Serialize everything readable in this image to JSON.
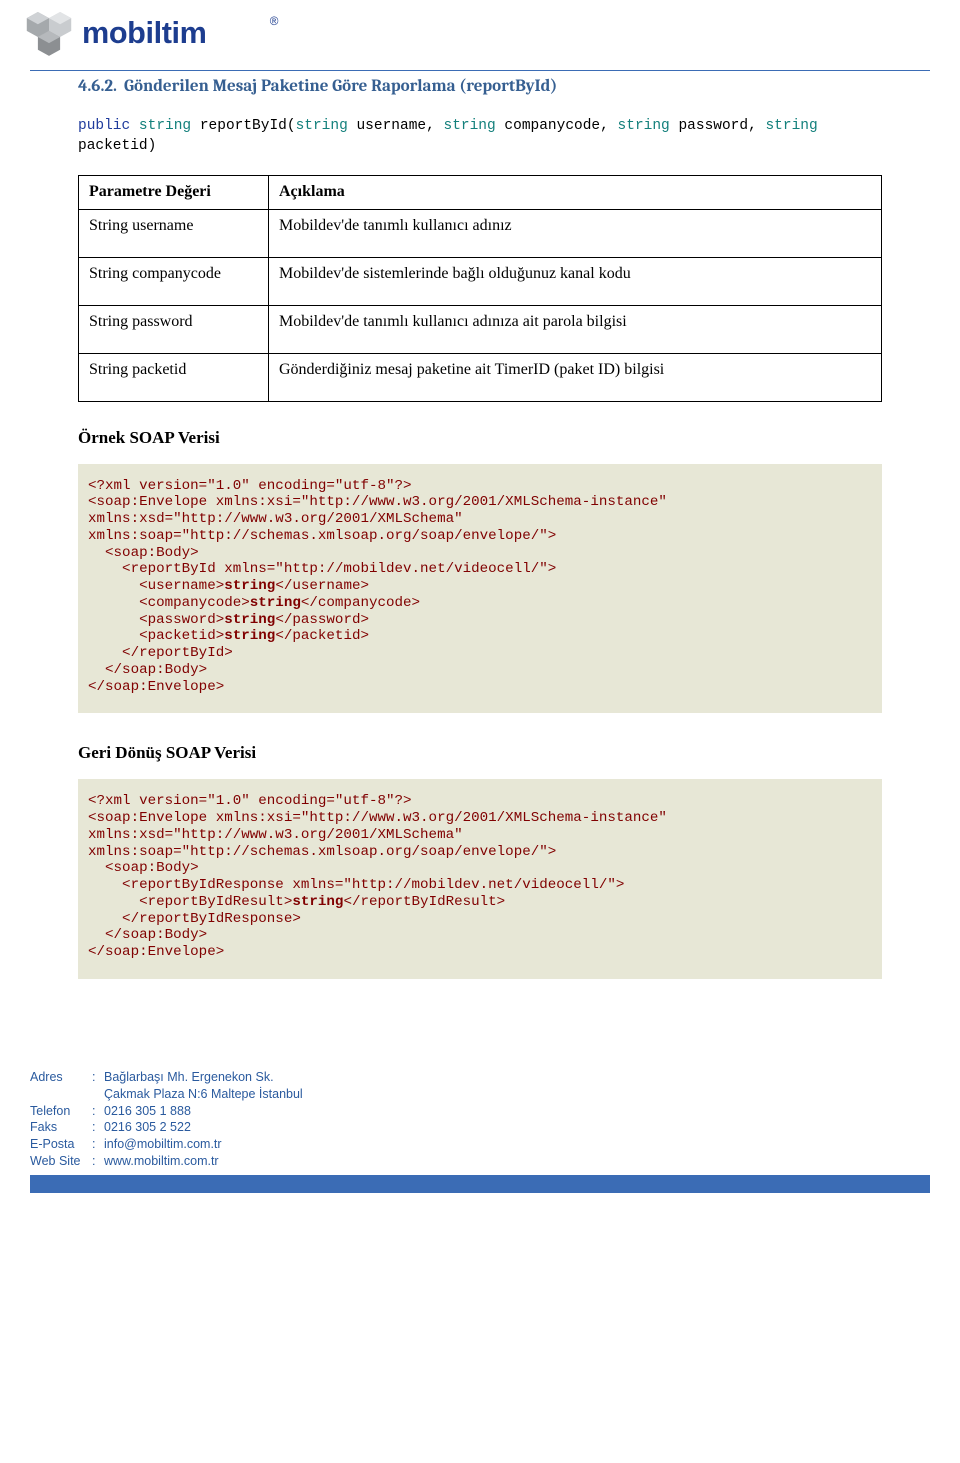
{
  "brand": "mobiltim",
  "section": {
    "num": "4.6.2.",
    "title": "Gönderilen Mesaj Paketine Göre Raporlama (reportById)"
  },
  "signature": {
    "kw_public": "public",
    "type_string": "string",
    "method": "reportById",
    "params_text": "string username, string companycode, string password, string packetid"
  },
  "table": {
    "header": {
      "c1": "Parametre Değeri",
      "c2": "Açıklama"
    },
    "rows": [
      {
        "c1": "String username",
        "c2": "Mobildev'de tanımlı kullanıcı adınız"
      },
      {
        "c1": "String companycode",
        "c2": "Mobildev'de sistemlerinde bağlı olduğunuz kanal kodu"
      },
      {
        "c1": "String password",
        "c2": "Mobildev'de tanımlı kullanıcı adınıza ait parola bilgisi"
      },
      {
        "c1": "String packetid",
        "c2": "Gönderdiğiniz mesaj paketine ait TimerID (paket ID) bilgisi"
      }
    ]
  },
  "example_heading": "Örnek SOAP Verisi",
  "code1": {
    "l1": "<?xml version=\"1.0\" encoding=\"utf-8\"?>",
    "l2": "<soap:Envelope xmlns:xsi=\"http://www.w3.org/2001/XMLSchema-instance\"",
    "l3": "xmlns:xsd=\"http://www.w3.org/2001/XMLSchema\"",
    "l4": "xmlns:soap=\"http://schemas.xmlsoap.org/soap/envelope/\">",
    "l5": "  <soap:Body>",
    "l6": "    <reportById xmlns=\"http://mobildev.net/videocell/\">",
    "l7a": "      <username>",
    "l7b": "string",
    "l7c": "</username>",
    "l8a": "      <companycode>",
    "l8b": "string",
    "l8c": "</companycode>",
    "l9a": "      <password>",
    "l9b": "string",
    "l9c": "</password>",
    "l10a": "      <packetid>",
    "l10b": "string",
    "l10c": "</packetid>",
    "l11": "    </reportById>",
    "l12": "  </soap:Body>",
    "l13": "</soap:Envelope>"
  },
  "return_heading": "Geri Dönüş SOAP Verisi",
  "code2": {
    "l1": "<?xml version=\"1.0\" encoding=\"utf-8\"?>",
    "l2": "<soap:Envelope xmlns:xsi=\"http://www.w3.org/2001/XMLSchema-instance\"",
    "l3": "xmlns:xsd=\"http://www.w3.org/2001/XMLSchema\"",
    "l4": "xmlns:soap=\"http://schemas.xmlsoap.org/soap/envelope/\">",
    "l5": "  <soap:Body>",
    "l6": "    <reportByIdResponse xmlns=\"http://mobildev.net/videocell/\">",
    "l7a": "      <reportByIdResult>",
    "l7b": "string",
    "l7c": "</reportByIdResult>",
    "l8": "    </reportByIdResponse>",
    "l9": "  </soap:Body>",
    "l10": "</soap:Envelope>"
  },
  "footer": {
    "addr_label": "Adres",
    "addr_val1": "Bağlarbaşı Mh. Ergenekon Sk.",
    "addr_val2": "Çakmak Plaza N:6 Maltepe İstanbul",
    "tel_label": "Telefon",
    "tel_val": "0216 305 1 888",
    "fax_label": "Faks",
    "fax_val": "0216 305 2 522",
    "email_label": "E-Posta",
    "email_val": "info@mobiltim.com.tr",
    "web_label": "Web Site",
    "web_val": "www.mobiltim.com.tr"
  }
}
